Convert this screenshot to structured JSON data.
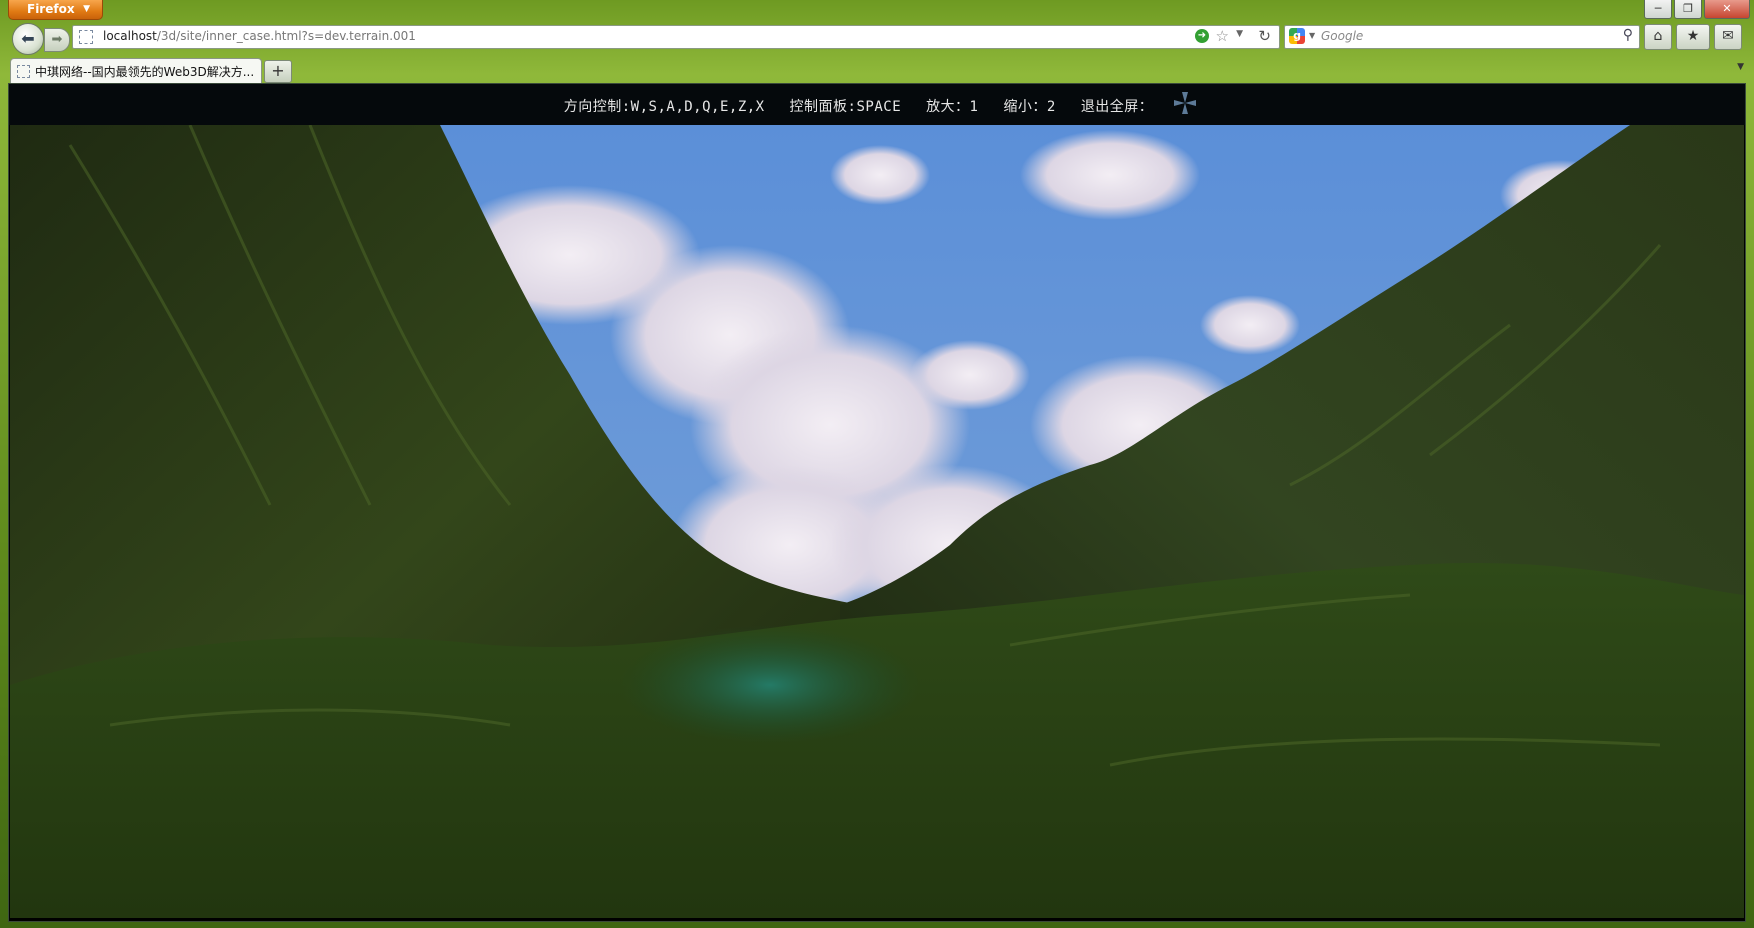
{
  "browser": {
    "app_button_label": "Firefox",
    "window_controls": {
      "minimize": "─",
      "restore": "❐",
      "close": "✕"
    }
  },
  "navbar": {
    "url_host": "localhost",
    "url_path": "/3d/site/inner_case.html?s=dev.terrain.001",
    "search_placeholder": "Google",
    "search_engine_letter": "g"
  },
  "tabs": [
    {
      "title": "中琪网络--国内最领先的Web3D解决方..."
    }
  ],
  "help_bar": {
    "direction": "方向控制:W,S,A,D,Q,E,Z,X",
    "panel": "控制面板:SPACE",
    "zoom_in": "放大：1",
    "zoom_out": "缩小：2",
    "exit_fullscreen": "退出全屏："
  },
  "colors": {
    "sky": "#5a8fd6",
    "terrain_dark": "#1e2a10",
    "terrain_mid": "#3f5a1c",
    "river": "#1f6e5a",
    "help_bar_bg": "#05090c"
  }
}
